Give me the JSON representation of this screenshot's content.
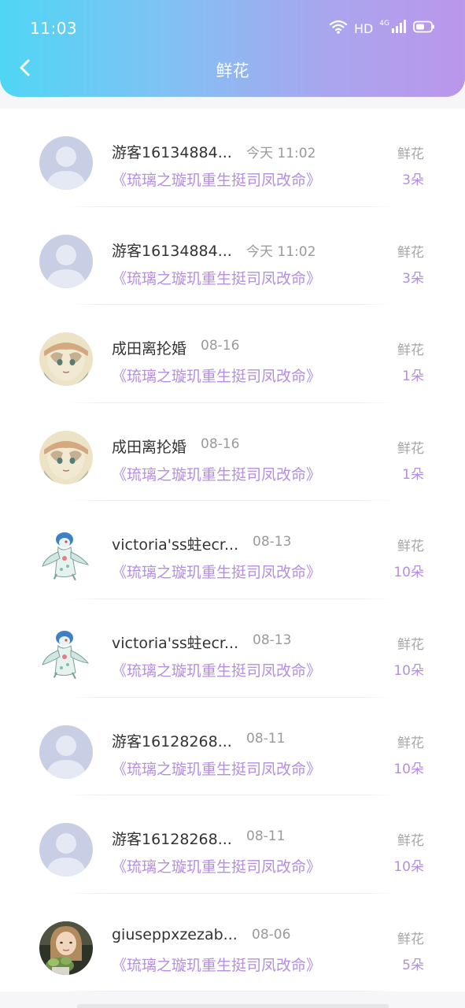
{
  "status_bar": {
    "time": "11:03",
    "hd_label": "HD",
    "network_label": "4G"
  },
  "header": {
    "title": "鲜花"
  },
  "colors": {
    "header_gradient": [
      "#4fd6f5",
      "#bb96ea"
    ],
    "accent_purple": "#b48ee2",
    "name_text": "#333333",
    "meta_text": "#9a9a9a"
  },
  "items": [
    {
      "name": "游客16134884...",
      "time": "今天 11:02",
      "book": "《琉璃之璇玑重生挺司凤改命》",
      "label": "鲜花",
      "count": "3朵",
      "avatar": "default-avatar"
    },
    {
      "name": "游客16134884...",
      "time": "今天 11:02",
      "book": "《琉璃之璇玑重生挺司凤改命》",
      "label": "鲜花",
      "count": "3朵",
      "avatar": "default-avatar"
    },
    {
      "name": "成田离抡婚",
      "time": "08-16",
      "book": "《琉璃之璇玑重生挺司凤改命》",
      "label": "鲜花",
      "count": "1朵",
      "avatar": "anime-girl-avatar"
    },
    {
      "name": "成田离抡婚",
      "time": "08-16",
      "book": "《琉璃之璇玑重生挺司凤改命》",
      "label": "鲜花",
      "count": "1朵",
      "avatar": "anime-girl-avatar"
    },
    {
      "name": "victoria'ss蛀ecr...",
      "time": "08-13",
      "book": "《琉璃之璇玑重生挺司凤改命》",
      "label": "鲜花",
      "count": "10朵",
      "avatar": "pokemon-avatar"
    },
    {
      "name": "victoria'ss蛀ecr...",
      "time": "08-13",
      "book": "《琉璃之璇玑重生挺司凤改命》",
      "label": "鲜花",
      "count": "10朵",
      "avatar": "pokemon-avatar"
    },
    {
      "name": "游客16128268...",
      "time": "08-11",
      "book": "《琉璃之璇玑重生挺司凤改命》",
      "label": "鲜花",
      "count": "10朵",
      "avatar": "default-avatar"
    },
    {
      "name": "游客16128268...",
      "time": "08-11",
      "book": "《琉璃之璇玑重生挺司凤改命》",
      "label": "鲜花",
      "count": "10朵",
      "avatar": "default-avatar"
    },
    {
      "name": "giuseppxzezab...",
      "time": "08-06",
      "book": "《琉璃之璇玑重生挺司凤改命》",
      "label": "鲜花",
      "count": "5朵",
      "avatar": "photo-avatar"
    }
  ]
}
